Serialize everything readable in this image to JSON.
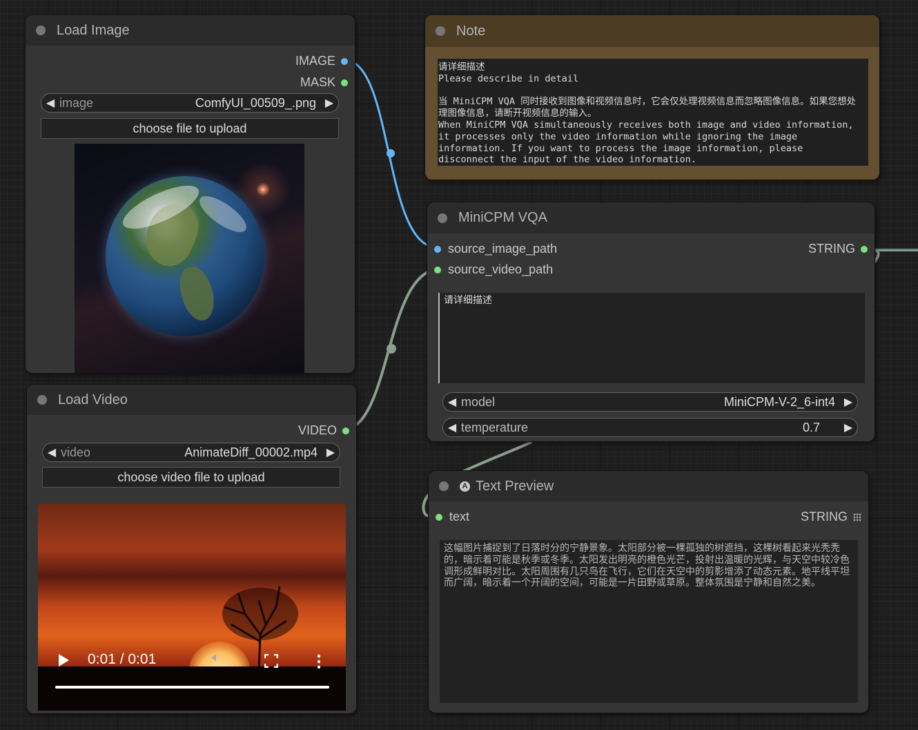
{
  "load_image": {
    "title": "Load Image",
    "outputs": {
      "image": "IMAGE",
      "mask": "MASK"
    },
    "image_widget": {
      "label": "image",
      "value": "ComfyUI_00509_.png"
    },
    "upload_button": "choose file to upload"
  },
  "load_video": {
    "title": "Load Video",
    "outputs": {
      "video": "VIDEO"
    },
    "video_widget": {
      "label": "video",
      "value": "AnimateDiff_00002.mp4"
    },
    "upload_button": "choose video file to upload",
    "player": {
      "time": "0:01 / 0:01",
      "progress": 1.0
    }
  },
  "note": {
    "title": "Note",
    "text": "请详细描述\nPlease describe in detail\n\n当 MiniCPM VQA 同时接收到图像和视频信息时，它会仅处理视频信息而忽略图像信息。如果您想处理图像信息，请断开视频信息的输入。\nWhen MiniCPM VQA simultaneously receives both image and video information, it processes only the video information while ignoring the image information. If you want to process the image information, please disconnect the input of the video information."
  },
  "minicpm": {
    "title": "MiniCPM VQA",
    "inputs": {
      "image": "source_image_path",
      "video": "source_video_path"
    },
    "outputs": {
      "string": "STRING"
    },
    "prompt": "请详细描述",
    "model_widget": {
      "label": "model",
      "value": "MiniCPM-V-2_6-int4"
    },
    "temperature_widget": {
      "label": "temperature",
      "value": "0.7"
    }
  },
  "text_preview": {
    "title": "Text Preview",
    "badge": "A",
    "inputs": {
      "text": "text"
    },
    "outputs": {
      "string": "STRING"
    },
    "text": "这幅图片捕捉到了日落时分的宁静景象。太阳部分被一棵孤独的树遮挡，这棵树看起来光秃秃的，暗示着可能是秋季或冬季。太阳发出明亮的橙色光芒，投射出温暖的光辉，与天空中较冷色调形成鲜明对比。太阳周围有几只鸟在飞行，它们在天空中的剪影增添了动态元素。地平线平坦而广阔，暗示着一个开阔的空间，可能是一片田野或草原。整体氛围是宁静和自然之美。"
  },
  "colors": {
    "image_link": "#64b5f6",
    "video_link": "#8a9e8c",
    "string_dot": "#7ee07e",
    "note_title_bg": "#4b3c23",
    "note_body_bg": "#645030"
  }
}
